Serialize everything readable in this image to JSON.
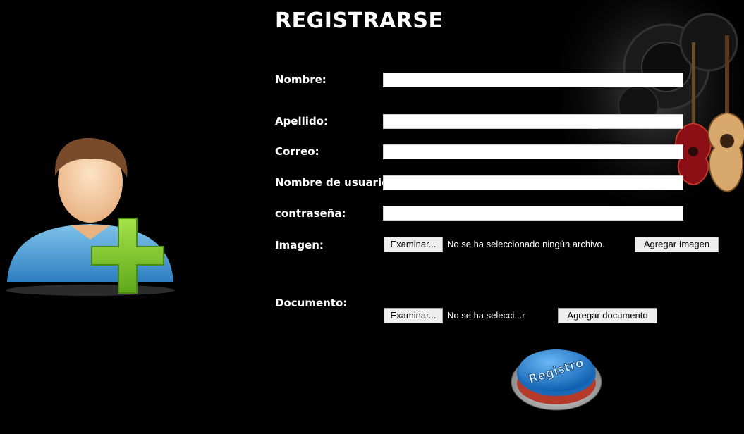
{
  "header": {
    "title": "REGISTRARSE"
  },
  "form": {
    "nombre": {
      "label": "Nombre:",
      "value": ""
    },
    "apellido": {
      "label": "Apellido:",
      "value": ""
    },
    "correo": {
      "label": "Correo:",
      "value": ""
    },
    "usuario": {
      "label": "Nombre de usuario:",
      "value": ""
    },
    "contrasena": {
      "label": "contraseña:",
      "value": ""
    },
    "imagen": {
      "label": "Imagen:",
      "browse_label": "Examinar...",
      "file_status": "No se ha seleccionado ningún archivo.",
      "add_label": "Agregar Imagen"
    },
    "documento": {
      "label": "Documento:",
      "browse_label": "Examinar...",
      "file_status": "No se ha selecci...r",
      "add_label": "Agregar documento"
    },
    "submit": {
      "text": "Registro"
    }
  },
  "colors": {
    "background": "#000000",
    "submit_blue": "#1e7fd6",
    "plus_green": "#7cc520"
  },
  "icons": {
    "avatar": "add-user-icon",
    "decoration": "guitars-image"
  }
}
